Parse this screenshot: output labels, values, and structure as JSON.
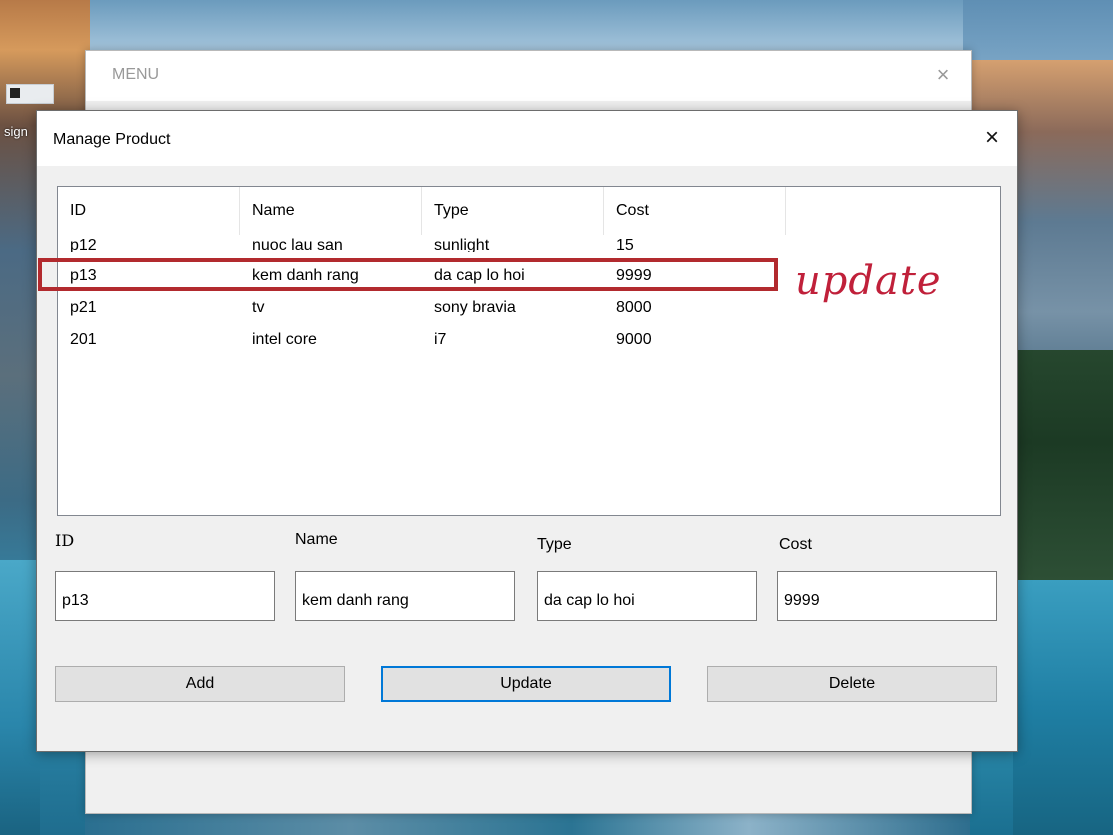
{
  "desktop": {
    "label_fragment": "sign"
  },
  "menu_window": {
    "title": "MENU",
    "close_glyph": "×"
  },
  "dialog": {
    "title": "Manage Product",
    "close_glyph": "×",
    "list": {
      "columns": [
        "ID",
        "Name",
        "Type",
        "Cost"
      ],
      "rows": [
        [
          "p12",
          "nuoc lau san",
          "sunlight",
          "15"
        ],
        [
          "p13",
          "kem danh rang",
          "da cap lo hoi",
          "9999"
        ],
        [
          "p21",
          "tv",
          "sony bravia",
          "8000"
        ],
        [
          "201",
          "intel core",
          "i7",
          "9000"
        ]
      ]
    },
    "form": {
      "id_label": "ID",
      "name_label": "Name",
      "type_label": "Type",
      "cost_label": "Cost",
      "id_value": "p13",
      "name_value": "kem danh rang",
      "type_value": "da cap lo hoi",
      "cost_value": "9999"
    },
    "buttons": {
      "add": "Add",
      "update": "Update",
      "delete": "Delete"
    }
  },
  "annotation": {
    "text": "update",
    "color": "#c0203a",
    "box_color": "#b22a2e"
  },
  "icons": {
    "close": "close-icon"
  }
}
